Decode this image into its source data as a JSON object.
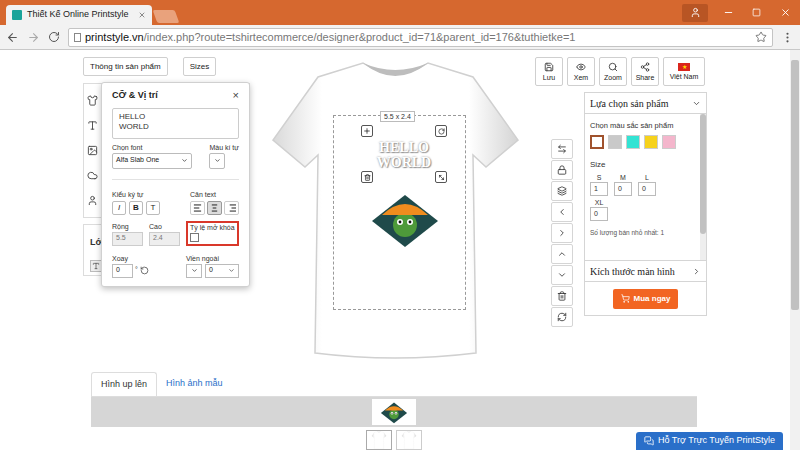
{
  "window": {
    "tab_title": "Thiết Kế Online Printstyle"
  },
  "address_bar": {
    "host": "printstyle.vn",
    "path": "/index.php?route=tshirtecommerce/designer&product_id=71&parent_id=176&tuthietke=1"
  },
  "top_buttons": [
    "Thông tin sản phẩm",
    "Sizes"
  ],
  "left_tools": {
    "hidden_label": "Lớ"
  },
  "text_panel": {
    "title": "CỠ & Vị trí",
    "close": "×",
    "text_lines": [
      "HELLO",
      "WORLD"
    ],
    "font_label": "Chọn font",
    "font": "Alfa Slab One",
    "color_label": "Màu kí tự",
    "style_label": "Kiểu ký tự",
    "style_buttons": [
      {
        "label": "I",
        "selected": false
      },
      {
        "label": "B",
        "selected": false
      },
      {
        "label": "T",
        "selected": false
      }
    ],
    "align_label": "Căn text",
    "align": [
      {
        "value": "left",
        "selected": false
      },
      {
        "value": "center",
        "selected": true
      },
      {
        "value": "right",
        "selected": false
      }
    ],
    "width_label": "Rộng",
    "width": "5.5",
    "height_label": "Cao",
    "height": "2.4",
    "lock_label": "Tỷ lệ mở khóa",
    "lock_checked": false,
    "lock_highlighted": true,
    "rotate_label": "Xoay",
    "rotate": "0",
    "degree": "°",
    "outline_label": "Viền ngoài",
    "outline": "0"
  },
  "canvas": {
    "size_label": "5.5 x 2.4",
    "text_lines": [
      "HELLO",
      "WORLD"
    ]
  },
  "actions": [
    "Lưu",
    "Xem",
    "Zoom",
    "Share",
    "Việt Nam"
  ],
  "product_panel": {
    "title": "Lựa chọn sản phẩm",
    "color_label": "Chọn màu sắc sản phẩm",
    "colors": [
      {
        "color": "#ffffff",
        "selected": true
      },
      {
        "color": "#c9c9c9",
        "selected": false
      },
      {
        "color": "#33e3d3",
        "selected": false
      },
      {
        "color": "#f6d21c",
        "selected": false
      },
      {
        "color": "#f4b6cc",
        "selected": false
      }
    ],
    "size_label": "Size",
    "sizes": [
      {
        "label": "S",
        "qty": "1"
      },
      {
        "label": "M",
        "qty": "0"
      },
      {
        "label": "L",
        "qty": "0"
      },
      {
        "label": "XL",
        "qty": "0"
      }
    ],
    "min_qty": "Số lượng bán nhỏ nhất: 1",
    "screen_size": "Kích thước màn hình",
    "buy": "Mua ngay"
  },
  "bottom_tabs": [
    {
      "label": "Hình up lên",
      "selected": true
    },
    {
      "label": "Hình ảnh mẫu",
      "selected": false
    }
  ],
  "support_button": "Hỗ Trợ Trực Tuyến PrintStyle"
}
